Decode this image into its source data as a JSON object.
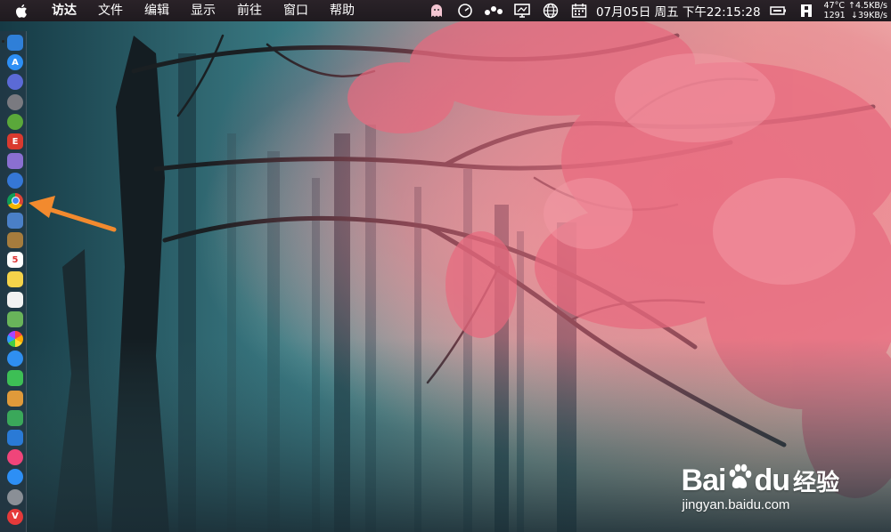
{
  "menubar": {
    "apple_icon": "apple-logo-icon",
    "items": [
      "访达",
      "文件",
      "编辑",
      "显示",
      "前往",
      "窗口",
      "帮助"
    ],
    "clock": "07月05日 周五 下午22:15:28",
    "stats": {
      "temp": "47°C",
      "fan": "1291",
      "upload": "↑4.5KB/s",
      "download": "↓39KB/s"
    },
    "status_icons": [
      "ghost-icon",
      "speedometer-icon",
      "dots-icon",
      "screen-icon",
      "globe-icon",
      "calendar-icon",
      "battery-icon",
      "profile-icon"
    ]
  },
  "dock": {
    "items": [
      {
        "name": "finder-icon",
        "color": "#2f7fd8",
        "glyph": ""
      },
      {
        "name": "app-store-icon",
        "color": "#2d8ff5",
        "glyph": "A"
      },
      {
        "name": "siri-icon",
        "color": "#5b6ad6",
        "glyph": ""
      },
      {
        "name": "launchpad-icon",
        "color": "#7a7a80",
        "glyph": ""
      },
      {
        "name": "android-studio-icon",
        "color": "#5aa83a",
        "glyph": ""
      },
      {
        "name": "app-red-icon",
        "color": "#d93a2f",
        "glyph": "E"
      },
      {
        "name": "app-purple-icon",
        "color": "#8a6fd1",
        "glyph": ""
      },
      {
        "name": "safari-icon",
        "color": "#3577d6",
        "glyph": ""
      },
      {
        "name": "chrome-icon",
        "color": "#ffffff",
        "glyph": ""
      },
      {
        "name": "preview-icon",
        "color": "#4a7fc7",
        "glyph": ""
      },
      {
        "name": "notebook-icon",
        "color": "#a67c3d",
        "glyph": ""
      },
      {
        "name": "calendar-app-icon",
        "color": "#ffffff",
        "glyph": "5"
      },
      {
        "name": "notes-icon",
        "color": "#f4d34a",
        "glyph": ""
      },
      {
        "name": "reminders-icon",
        "color": "#f2f2f2",
        "glyph": ""
      },
      {
        "name": "maps-icon",
        "color": "#69b45a",
        "glyph": ""
      },
      {
        "name": "photos-icon",
        "color": "#f5f5f5",
        "glyph": ""
      },
      {
        "name": "messages-icon",
        "color": "#2f8ff0",
        "glyph": ""
      },
      {
        "name": "facetime-icon",
        "color": "#3dbf55",
        "glyph": ""
      },
      {
        "name": "pages-icon",
        "color": "#e09a3a",
        "glyph": ""
      },
      {
        "name": "numbers-icon",
        "color": "#3aa85a",
        "glyph": ""
      },
      {
        "name": "keynote-icon",
        "color": "#2a7ad6",
        "glyph": ""
      },
      {
        "name": "music-icon",
        "color": "#f0457a",
        "glyph": ""
      },
      {
        "name": "app-store-2-icon",
        "color": "#2d8ff5",
        "glyph": ""
      },
      {
        "name": "system-preferences-icon",
        "color": "#8a8f96",
        "glyph": ""
      },
      {
        "name": "vivaldi-icon",
        "color": "#e53a3a",
        "glyph": "V"
      }
    ]
  },
  "watermark": {
    "brand": "Bai",
    "brand2": "du",
    "cn": "经验",
    "url": "jingyan.baidu.com"
  },
  "colors": {
    "menubar": "#231d22",
    "arrow": "#f28a2e",
    "sky": "#d8c9b6",
    "fog": "#5d9aa3",
    "leaves": "#e2677a"
  }
}
